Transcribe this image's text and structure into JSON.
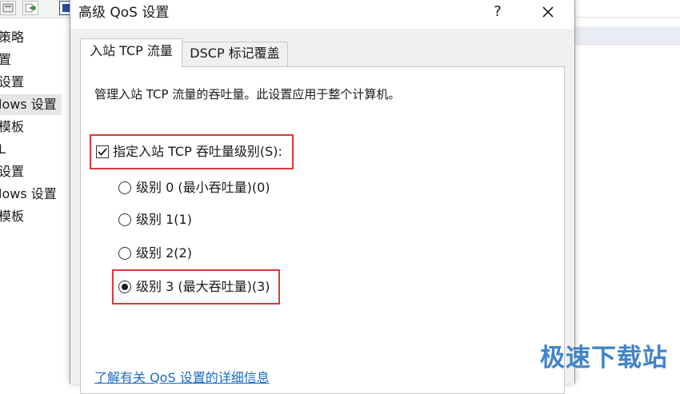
{
  "background": {
    "tree_items": [
      {
        "label": "策略"
      },
      {
        "label": "置"
      },
      {
        "label": "设置"
      },
      {
        "label": "lows 设置"
      },
      {
        "label": "模板"
      },
      {
        "label": "L"
      },
      {
        "label": "设置"
      },
      {
        "label": "lows 设置"
      },
      {
        "label": "模板"
      }
    ]
  },
  "dialog": {
    "title": "高级 QoS 设置",
    "help_label": "?",
    "tabs": [
      {
        "label": "入站 TCP 流量",
        "active": true
      },
      {
        "label": "DSCP 标记覆盖",
        "active": false
      }
    ],
    "description": "管理入站 TCP 流量的吞吐量。此设置应用于整个计算机。",
    "checkbox": {
      "label": "指定入站 TCP 吞吐量级别(S):",
      "checked": true
    },
    "radios": [
      {
        "label": "级别 0 (最小吞吐量)(0)",
        "checked": false
      },
      {
        "label": "级别 1(1)",
        "checked": false
      },
      {
        "label": "级别 2(2)",
        "checked": false
      },
      {
        "label": "级别 3 (最大吞吐量)(3)",
        "checked": true
      }
    ],
    "link": "了解有关 QoS 设置的详细信息"
  },
  "watermark": "极速下载站",
  "colors": {
    "highlight": "#d9383f",
    "link": "#1a6ac7",
    "watermark": "#1f6fc4"
  }
}
